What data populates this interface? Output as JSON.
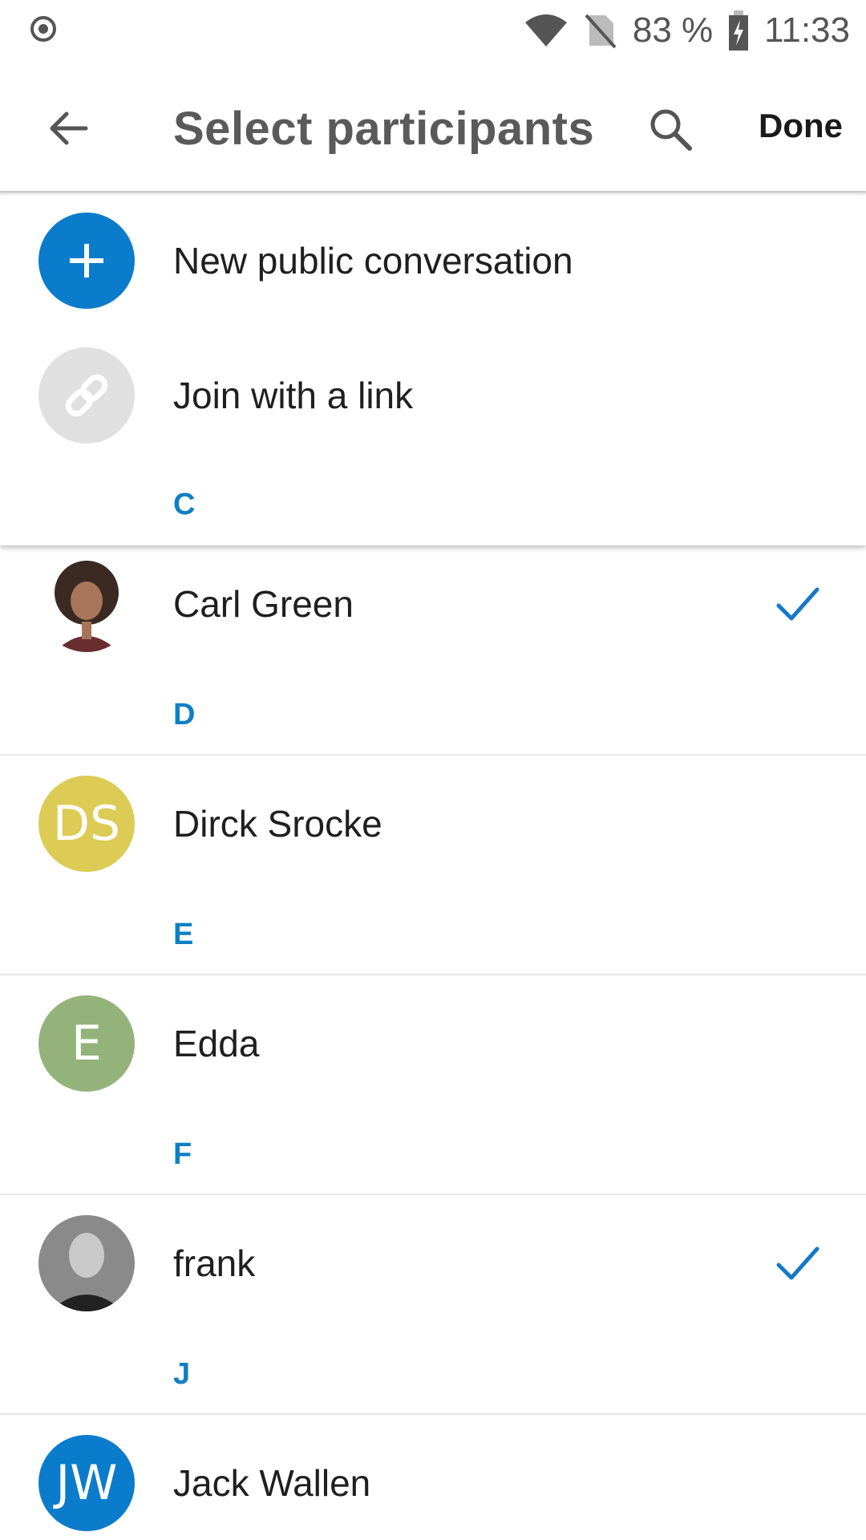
{
  "status_bar": {
    "left_icon": "record-icon",
    "battery_percent": "83 %",
    "time": "11:33",
    "icons": [
      "wifi-icon",
      "no-sim-icon",
      "battery-charging-icon"
    ]
  },
  "app_bar": {
    "back_icon": "arrow-back-icon",
    "title": "Select participants",
    "search_icon": "search-icon",
    "done_label": "Done"
  },
  "actions": [
    {
      "label": "New public conversation",
      "icon": "plus-icon",
      "color": "#0b7ccb"
    },
    {
      "label": "Join with a link",
      "icon": "link-icon",
      "color": "#e0e0e0"
    }
  ],
  "contacts": [
    {
      "section": "C",
      "name": "Carl Green",
      "avatar": "photo",
      "selected": true
    },
    {
      "section": "D",
      "name": "Dirck Srocke",
      "initials": "DS",
      "color": "#dccb55",
      "selected": false
    },
    {
      "section": "E",
      "name": "Edda",
      "initials": "E",
      "color": "#94b37a",
      "selected": false
    },
    {
      "section": "F",
      "name": "frank",
      "avatar": "photo",
      "selected": true
    },
    {
      "section": "J",
      "name": "Jack Wallen",
      "initials": "JW",
      "color": "#0b7ccb",
      "selected": false
    }
  ],
  "colors": {
    "accent": "#0f7fc4",
    "check": "#1478c8",
    "text": "#1f1f1f",
    "divider": "#e6e6e6"
  }
}
